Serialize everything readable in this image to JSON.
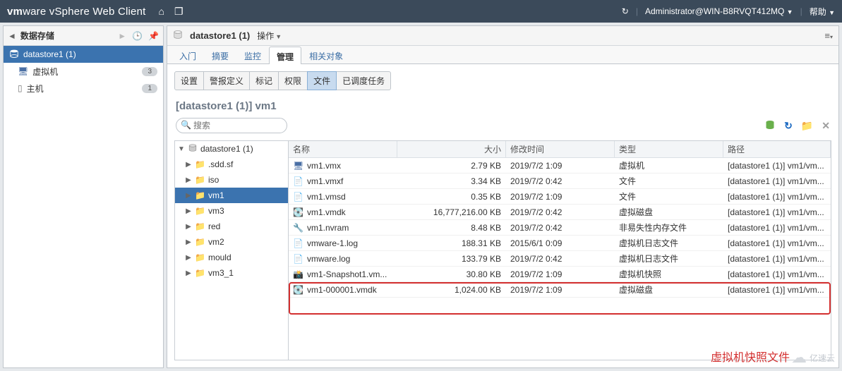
{
  "topbar": {
    "brand_bold": "vm",
    "brand_rest": "ware",
    "product": " vSphere Web Client",
    "user": "Administrator@WIN-B8RVQT412MQ",
    "help": "帮助"
  },
  "sidebar": {
    "breadcrumb": "数据存储",
    "selected": "datastore1 (1)",
    "items": [
      {
        "label": "虚拟机",
        "count": "3"
      },
      {
        "label": "主机",
        "count": "1"
      }
    ]
  },
  "content": {
    "title": "datastore1 (1)",
    "actions_label": "操作",
    "tabs": [
      "入门",
      "摘要",
      "监控",
      "管理",
      "相关对象"
    ],
    "active_tab": 3,
    "subtabs": [
      "设置",
      "警报定义",
      "标记",
      "权限",
      "文件",
      "已调度任务"
    ],
    "active_subtab": 4,
    "path": "[datastore1 (1)] vm1",
    "search_placeholder": "搜索"
  },
  "tree": [
    {
      "label": "datastore1 (1)",
      "icon": "cyl",
      "depth": 0,
      "expanded": true
    },
    {
      "label": ".sdd.sf",
      "icon": "fld",
      "depth": 1,
      "expanded": false
    },
    {
      "label": "iso",
      "icon": "fld",
      "depth": 1,
      "expanded": false
    },
    {
      "label": "vm1",
      "icon": "fld",
      "depth": 1,
      "expanded": false,
      "selected": true
    },
    {
      "label": "vm3",
      "icon": "fld",
      "depth": 1,
      "expanded": false
    },
    {
      "label": "red",
      "icon": "fld",
      "depth": 1,
      "expanded": false
    },
    {
      "label": "vm2",
      "icon": "fld",
      "depth": 1,
      "expanded": false
    },
    {
      "label": "mould",
      "icon": "fld",
      "depth": 1,
      "expanded": false
    },
    {
      "label": "vm3_1",
      "icon": "fld",
      "depth": 1,
      "expanded": false
    }
  ],
  "table": {
    "columns": [
      "名称",
      "大小",
      "修改时间",
      "类型",
      "路径"
    ],
    "rows": [
      {
        "icon": "vmx",
        "name": "vm1.vmx",
        "size": "2.79 KB",
        "mtime": "2019/7/2 1:09",
        "type": "虚拟机",
        "path": "[datastore1 (1)] vm1/vm..."
      },
      {
        "icon": "file",
        "name": "vm1.vmxf",
        "size": "3.34 KB",
        "mtime": "2019/7/2 0:42",
        "type": "文件",
        "path": "[datastore1 (1)] vm1/vm..."
      },
      {
        "icon": "file",
        "name": "vm1.vmsd",
        "size": "0.35 KB",
        "mtime": "2019/7/2 1:09",
        "type": "文件",
        "path": "[datastore1 (1)] vm1/vm..."
      },
      {
        "icon": "disk",
        "name": "vm1.vmdk",
        "size": "16,777,216.00 KB",
        "mtime": "2019/7/2 0:42",
        "type": "虚拟磁盘",
        "path": "[datastore1 (1)] vm1/vm..."
      },
      {
        "icon": "nvram",
        "name": "vm1.nvram",
        "size": "8.48 KB",
        "mtime": "2019/7/2 0:42",
        "type": "非易失性内存文件",
        "path": "[datastore1 (1)] vm1/vm..."
      },
      {
        "icon": "log",
        "name": "vmware-1.log",
        "size": "188.31 KB",
        "mtime": "2015/6/1 0:09",
        "type": "虚拟机日志文件",
        "path": "[datastore1 (1)] vm1/vm..."
      },
      {
        "icon": "log",
        "name": "vmware.log",
        "size": "133.79 KB",
        "mtime": "2019/7/2 0:42",
        "type": "虚拟机日志文件",
        "path": "[datastore1 (1)] vm1/vm..."
      },
      {
        "icon": "snap",
        "name": "vm1-Snapshot1.vm...",
        "size": "30.80 KB",
        "mtime": "2019/7/2 1:09",
        "type": "虚拟机快照",
        "path": "[datastore1 (1)] vm1/vm..."
      },
      {
        "icon": "disk",
        "name": "vm1-000001.vmdk",
        "size": "1,024.00 KB",
        "mtime": "2019/7/2 1:09",
        "type": "虚拟磁盘",
        "path": "[datastore1 (1)] vm1/vm..."
      }
    ]
  },
  "annotation": "虚拟机快照文件",
  "watermark": "亿速云"
}
